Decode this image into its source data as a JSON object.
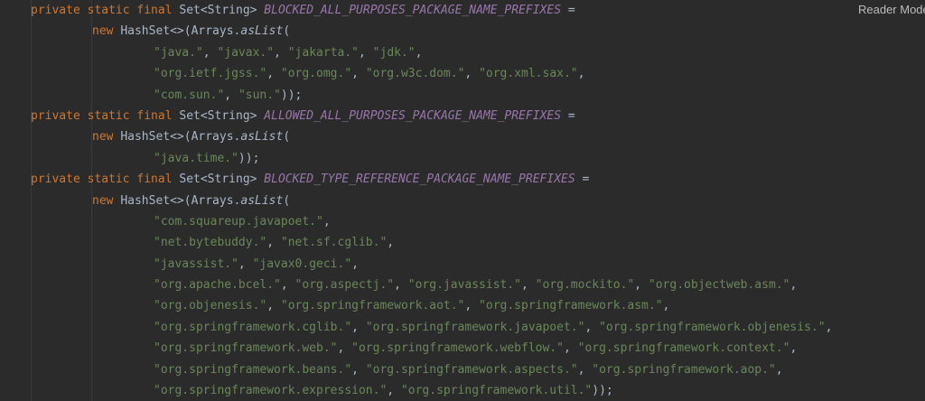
{
  "reader_mode_label": "Reader Mode",
  "lines": [
    {
      "indent": 0,
      "tokens": [
        {
          "c": "kw",
          "t": "private static final "
        },
        {
          "c": "type",
          "t": "Set<String> "
        },
        {
          "c": "const",
          "t": "BLOCKED_ALL_PURPOSES_PACKAGE_NAME_PREFIXES"
        },
        {
          "c": "op",
          "t": " ="
        }
      ]
    },
    {
      "indent": 1,
      "tokens": [
        {
          "c": "kw",
          "t": "new "
        },
        {
          "c": "type",
          "t": "HashSet<>(Arrays."
        },
        {
          "c": "method",
          "t": "asList"
        },
        {
          "c": "punc",
          "t": "("
        }
      ]
    },
    {
      "indent": 2,
      "tokens": [
        {
          "c": "str",
          "t": "\"java.\""
        },
        {
          "c": "punc",
          "t": ", "
        },
        {
          "c": "str",
          "t": "\"javax.\""
        },
        {
          "c": "punc",
          "t": ", "
        },
        {
          "c": "str",
          "t": "\"jakarta.\""
        },
        {
          "c": "punc",
          "t": ", "
        },
        {
          "c": "str",
          "t": "\"jdk.\""
        },
        {
          "c": "punc",
          "t": ","
        }
      ]
    },
    {
      "indent": 2,
      "tokens": [
        {
          "c": "str",
          "t": "\"org.ietf.jgss.\""
        },
        {
          "c": "punc",
          "t": ", "
        },
        {
          "c": "str",
          "t": "\"org.omg.\""
        },
        {
          "c": "punc",
          "t": ", "
        },
        {
          "c": "str",
          "t": "\"org.w3c.dom.\""
        },
        {
          "c": "punc",
          "t": ", "
        },
        {
          "c": "str",
          "t": "\"org.xml.sax.\""
        },
        {
          "c": "punc",
          "t": ","
        }
      ]
    },
    {
      "indent": 2,
      "tokens": [
        {
          "c": "str",
          "t": "\"com.sun.\""
        },
        {
          "c": "punc",
          "t": ", "
        },
        {
          "c": "str",
          "t": "\"sun.\""
        },
        {
          "c": "punc",
          "t": "));"
        }
      ]
    },
    {
      "indent": 0,
      "tokens": [
        {
          "c": "kw",
          "t": "private static final "
        },
        {
          "c": "type",
          "t": "Set<String> "
        },
        {
          "c": "const",
          "t": "ALLOWED_ALL_PURPOSES_PACKAGE_NAME_PREFIXES"
        },
        {
          "c": "op",
          "t": " ="
        }
      ]
    },
    {
      "indent": 1,
      "tokens": [
        {
          "c": "kw",
          "t": "new "
        },
        {
          "c": "type",
          "t": "HashSet<>(Arrays."
        },
        {
          "c": "method",
          "t": "asList"
        },
        {
          "c": "punc",
          "t": "("
        }
      ]
    },
    {
      "indent": 2,
      "tokens": [
        {
          "c": "str",
          "t": "\"java.time.\""
        },
        {
          "c": "punc",
          "t": "));"
        }
      ]
    },
    {
      "indent": 0,
      "tokens": [
        {
          "c": "kw",
          "t": "private static final "
        },
        {
          "c": "type",
          "t": "Set<String> "
        },
        {
          "c": "const",
          "t": "BLOCKED_TYPE_REFERENCE_PACKAGE_NAME_PREFIXES"
        },
        {
          "c": "op",
          "t": " ="
        }
      ]
    },
    {
      "indent": 1,
      "tokens": [
        {
          "c": "kw",
          "t": "new "
        },
        {
          "c": "type",
          "t": "HashSet<>(Arrays."
        },
        {
          "c": "method",
          "t": "asList"
        },
        {
          "c": "punc",
          "t": "("
        }
      ]
    },
    {
      "indent": 2,
      "tokens": [
        {
          "c": "str",
          "t": "\"com.squareup.javapoet.\""
        },
        {
          "c": "punc",
          "t": ","
        }
      ]
    },
    {
      "indent": 2,
      "tokens": [
        {
          "c": "str",
          "t": "\"net.bytebuddy.\""
        },
        {
          "c": "punc",
          "t": ", "
        },
        {
          "c": "str",
          "t": "\"net.sf.cglib.\""
        },
        {
          "c": "punc",
          "t": ","
        }
      ]
    },
    {
      "indent": 2,
      "tokens": [
        {
          "c": "str",
          "t": "\"javassist.\""
        },
        {
          "c": "punc",
          "t": ", "
        },
        {
          "c": "str",
          "t": "\"javax0.geci.\""
        },
        {
          "c": "punc",
          "t": ","
        }
      ]
    },
    {
      "indent": 2,
      "tokens": [
        {
          "c": "str",
          "t": "\"org.apache.bcel.\""
        },
        {
          "c": "punc",
          "t": ", "
        },
        {
          "c": "str",
          "t": "\"org.aspectj.\""
        },
        {
          "c": "punc",
          "t": ", "
        },
        {
          "c": "str",
          "t": "\"org.javassist.\""
        },
        {
          "c": "punc",
          "t": ", "
        },
        {
          "c": "str",
          "t": "\"org.mockito.\""
        },
        {
          "c": "punc",
          "t": ", "
        },
        {
          "c": "str",
          "t": "\"org.objectweb.asm.\""
        },
        {
          "c": "punc",
          "t": ","
        }
      ]
    },
    {
      "indent": 2,
      "tokens": [
        {
          "c": "str",
          "t": "\"org.objenesis.\""
        },
        {
          "c": "punc",
          "t": ", "
        },
        {
          "c": "str",
          "t": "\"org.springframework.aot.\""
        },
        {
          "c": "punc",
          "t": ", "
        },
        {
          "c": "str",
          "t": "\"org.springframework.asm.\""
        },
        {
          "c": "punc",
          "t": ","
        }
      ]
    },
    {
      "indent": 2,
      "tokens": [
        {
          "c": "str",
          "t": "\"org.springframework.cglib.\""
        },
        {
          "c": "punc",
          "t": ", "
        },
        {
          "c": "str",
          "t": "\"org.springframework.javapoet.\""
        },
        {
          "c": "punc",
          "t": ", "
        },
        {
          "c": "str",
          "t": "\"org.springframework.objenesis.\""
        },
        {
          "c": "punc",
          "t": ","
        }
      ]
    },
    {
      "indent": 2,
      "tokens": [
        {
          "c": "str",
          "t": "\"org.springframework.web.\""
        },
        {
          "c": "punc",
          "t": ", "
        },
        {
          "c": "str",
          "t": "\"org.springframework.webflow.\""
        },
        {
          "c": "punc",
          "t": ", "
        },
        {
          "c": "str",
          "t": "\"org.springframework.context.\""
        },
        {
          "c": "punc",
          "t": ","
        }
      ]
    },
    {
      "indent": 2,
      "tokens": [
        {
          "c": "str",
          "t": "\"org.springframework.beans.\""
        },
        {
          "c": "punc",
          "t": ", "
        },
        {
          "c": "str",
          "t": "\"org.springframework.aspects.\""
        },
        {
          "c": "punc",
          "t": ", "
        },
        {
          "c": "str",
          "t": "\"org.springframework.aop.\""
        },
        {
          "c": "punc",
          "t": ","
        }
      ]
    },
    {
      "indent": 2,
      "tokens": [
        {
          "c": "str",
          "t": "\"org.springframework.expression.\""
        },
        {
          "c": "punc",
          "t": ", "
        },
        {
          "c": "str",
          "t": "\"org.springframework.util.\""
        },
        {
          "c": "punc",
          "t": "));"
        }
      ]
    }
  ]
}
